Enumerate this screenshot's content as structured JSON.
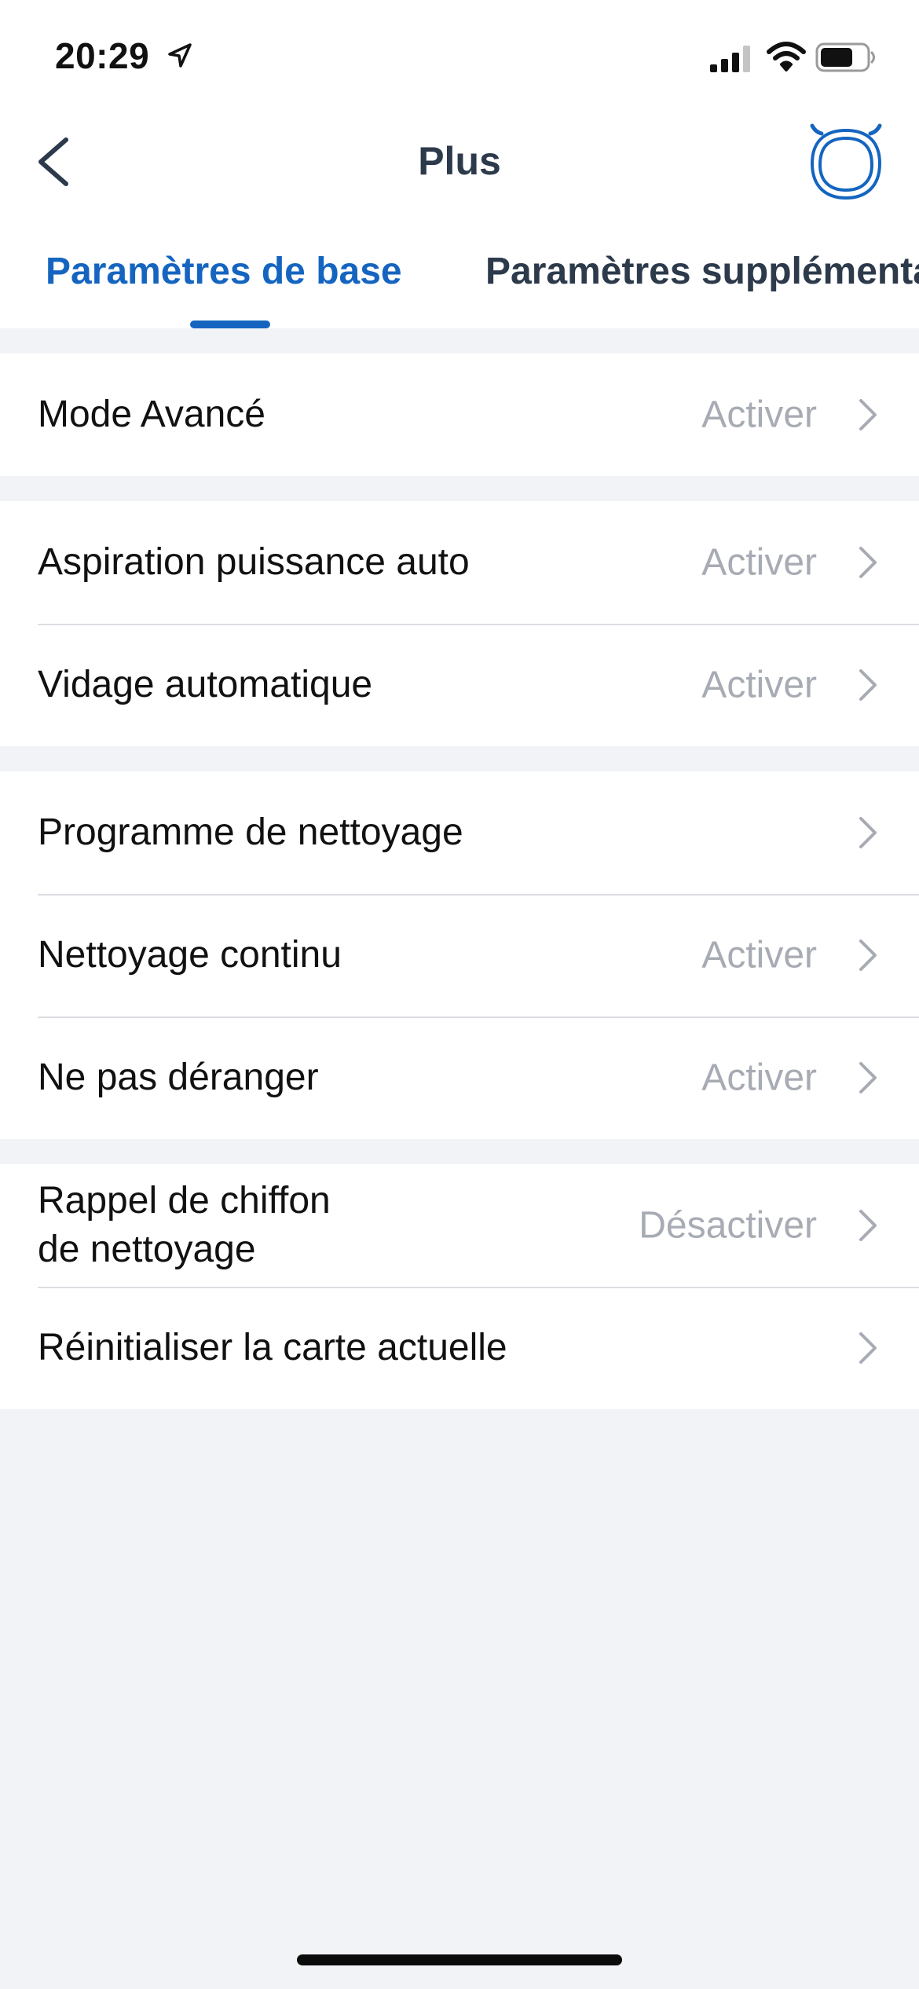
{
  "status_bar": {
    "time": "20:29",
    "icons": [
      "location-arrow-icon",
      "cellular-signal-icon",
      "wifi-icon",
      "battery-icon"
    ]
  },
  "nav": {
    "title": "Plus",
    "back_icon": "chevron-left-icon",
    "device_icon": "robot-vacuum-icon"
  },
  "tabs": [
    {
      "label": "Paramètres de base",
      "active": true
    },
    {
      "label": "Paramètres supplémentaires",
      "active": false
    }
  ],
  "colors": {
    "accent": "#1565c0",
    "title": "#2c3a4b",
    "secondary_text": "#a7abb3",
    "background": "#f2f3f7"
  },
  "groups": [
    {
      "rows": [
        {
          "label": "Mode Avancé",
          "value": "Activer"
        }
      ]
    },
    {
      "rows": [
        {
          "label": "Aspiration puissance auto",
          "value": "Activer"
        },
        {
          "label": "Vidage automatique",
          "value": "Activer"
        }
      ]
    },
    {
      "rows": [
        {
          "label": "Programme de nettoyage",
          "value": ""
        },
        {
          "label": "Nettoyage continu",
          "value": "Activer"
        },
        {
          "label": "Ne pas déranger",
          "value": "Activer"
        }
      ]
    },
    {
      "rows": [
        {
          "label_line1": "Rappel de chiffon",
          "label_line2": "de nettoyage",
          "value": "Désactiver"
        },
        {
          "label": "Réinitialiser la carte actuelle",
          "value": ""
        }
      ]
    }
  ]
}
